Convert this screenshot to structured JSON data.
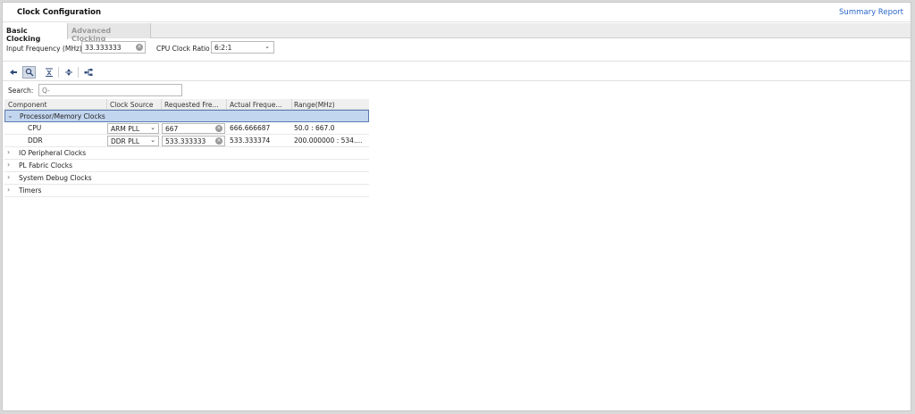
{
  "window": {
    "title": "Clock Configuration",
    "summary_link": "Summary Report"
  },
  "tabs": [
    {
      "label": "Basic Clocking"
    },
    {
      "label": "Advanced Clocking"
    }
  ],
  "inputs": {
    "input_frequency_label": "Input Frequency (MHz)",
    "input_frequency_value": "33.333333",
    "cpu_clock_ratio_label": "CPU Clock Ratio",
    "cpu_clock_ratio_value": "6:2:1"
  },
  "toolbar": {
    "icons": [
      "arrow-left-icon",
      "search-icon",
      "collapse-all-icon",
      "expand-all-icon",
      "hierarchy-icon"
    ]
  },
  "search": {
    "label": "Search:",
    "placeholder": "Q-"
  },
  "table": {
    "headers": [
      "Component",
      "Clock Source",
      "Requested Fre...",
      "Actual Freque...",
      "Range(MHz)"
    ],
    "group_selected": "Processor/Memory Clocks",
    "rows": [
      {
        "component": "CPU",
        "source": "ARM PLL",
        "requested": "667",
        "actual": "666.666687",
        "range": "50.0 : 667.0"
      },
      {
        "component": "DDR",
        "source": "DDR PLL",
        "requested": "533.333333",
        "actual": "533.333374",
        "range": "200.000000 : 534...."
      }
    ],
    "groups": [
      "IO Peripheral Clocks",
      "PL Fabric Clocks",
      "System Debug Clocks",
      "Timers"
    ]
  }
}
